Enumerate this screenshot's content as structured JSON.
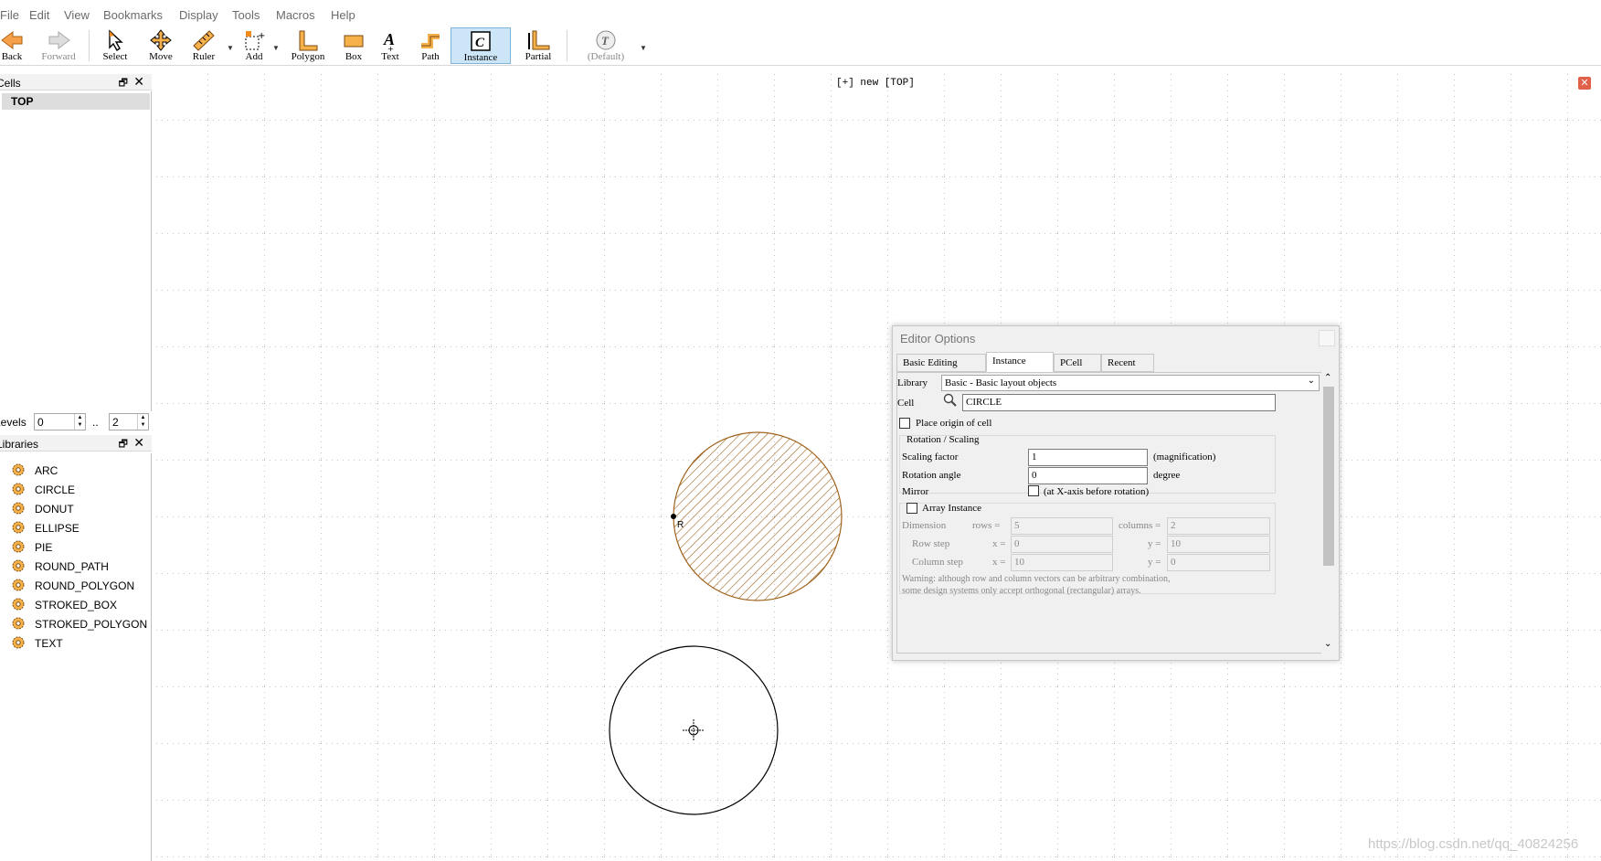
{
  "menu": [
    "File",
    "Edit",
    "View",
    "Bookmarks",
    "Display",
    "Tools",
    "Macros",
    "Help"
  ],
  "toolbar": {
    "back": "Back",
    "forward": "Forward",
    "select": "Select",
    "move": "Move",
    "ruler": "Ruler",
    "add": "Add",
    "polygon": "Polygon",
    "box": "Box",
    "text": "Text",
    "path": "Path",
    "instance": "Instance",
    "partial": "Partial",
    "default": "(Default)"
  },
  "cells_panel": {
    "title": "Cells",
    "top_cell": "TOP"
  },
  "levels": {
    "label": "Levels",
    "from": "0",
    "sep": "..",
    "to": "2"
  },
  "libraries": {
    "title": "Libraries",
    "items": [
      "ARC",
      "CIRCLE",
      "DONUT",
      "ELLIPSE",
      "PIE",
      "ROUND_PATH",
      "ROUND_POLYGON",
      "STROKED_BOX",
      "STROKED_POLYGON",
      "TEXT"
    ]
  },
  "canvas": {
    "title": "[+] new [TOP]",
    "cursor_label": "R",
    "watermark": "https://blog.csdn.net/qq_40824256"
  },
  "editor_options": {
    "title": "Editor Options",
    "tabs": [
      "Basic Editing",
      "Instance",
      "PCell",
      "Recent"
    ],
    "active_tab": "Instance",
    "library_label": "Library",
    "library_value": "Basic - Basic layout objects",
    "cell_label": "Cell",
    "cell_value": "CIRCLE",
    "place_origin": "Place origin of cell",
    "rotation_group": "Rotation / Scaling",
    "scaling_label": "Scaling factor",
    "scaling_value": "1",
    "scaling_unit": "(magnification)",
    "rotation_label": "Rotation angle",
    "rotation_value": "0",
    "rotation_unit": "degree",
    "mirror_label": "Mirror",
    "mirror_text": "(at X-axis before rotation)",
    "array_label": "Array Instance",
    "dimension_label": "Dimension",
    "rows_label": "rows =",
    "rows_value": "5",
    "columns_label": "columns =",
    "columns_value": "2",
    "row_step_label": "Row step",
    "row_x_label": "x =",
    "row_x_value": "0",
    "row_y_label": "y =",
    "row_y_value": "10",
    "col_step_label": "Column step",
    "col_x_label": "x =",
    "col_x_value": "10",
    "col_y_label": "y =",
    "col_y_value": "0",
    "warning_line1": "Warning: although row and column vectors can be arbitrary combination,",
    "warning_line2": "some design systems only accept orthogonal (rectangular) arrays."
  },
  "colors": {
    "hatch": "#a0641e",
    "active_tool_bg": "#cde6f7",
    "close_red": "#e0604a"
  }
}
